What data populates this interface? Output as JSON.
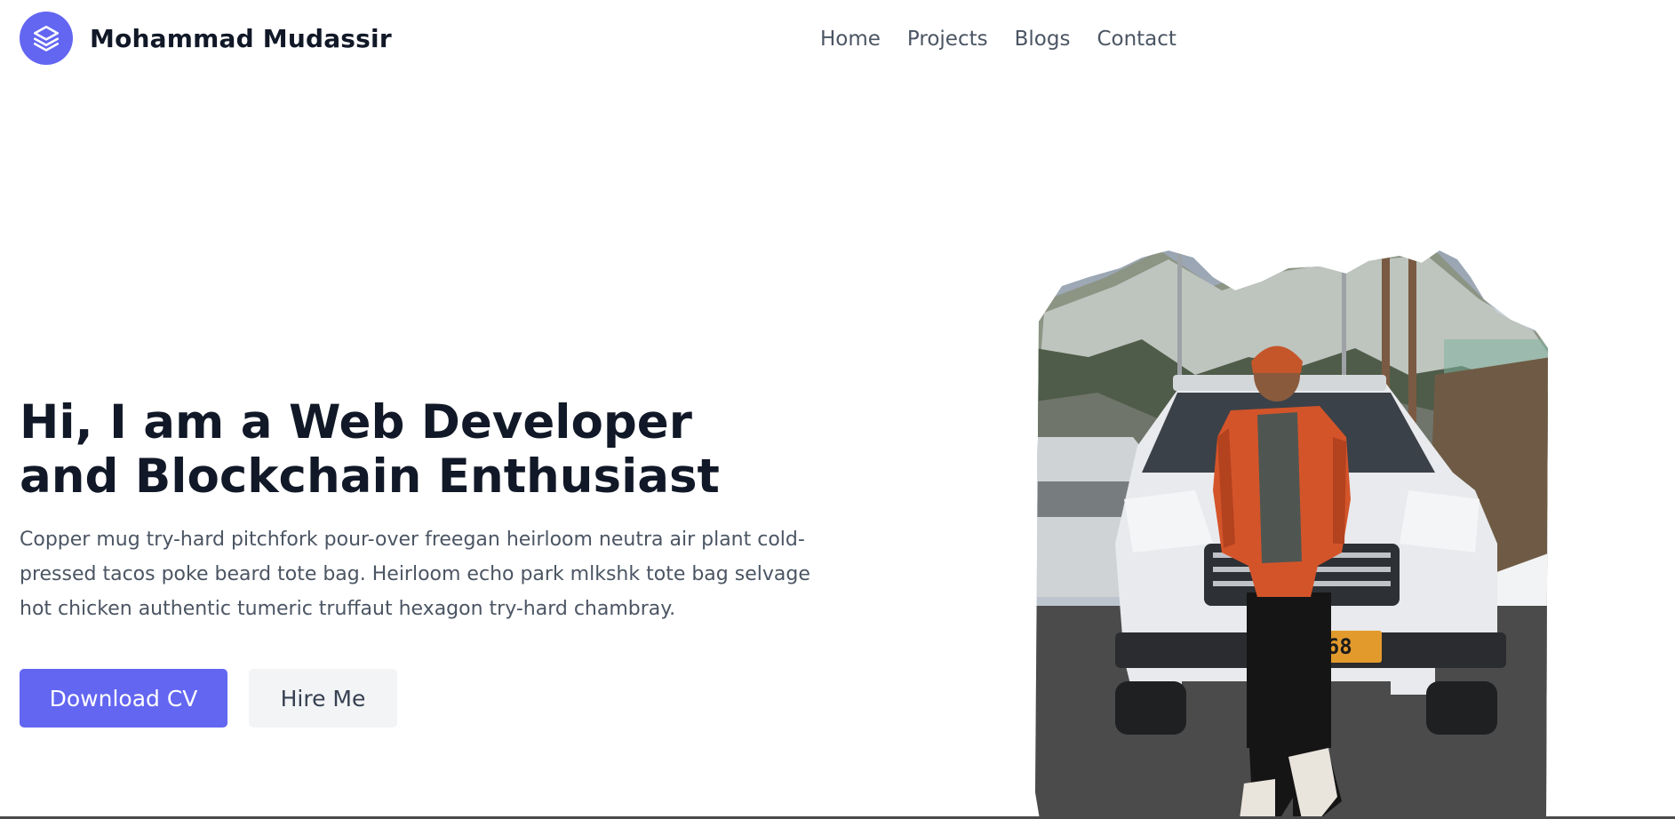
{
  "header": {
    "brand_name": "Mohammad Mudassir",
    "logo_icon": "layers-icon",
    "nav": [
      {
        "label": "Home"
      },
      {
        "label": "Projects"
      },
      {
        "label": "Blogs"
      },
      {
        "label": "Contact"
      }
    ]
  },
  "hero": {
    "title_line1": "Hi, I am a Web Developer",
    "title_line2": "and Blockchain Enthusiast",
    "description": "Copper mug try-hard pitchfork pour-over freegan heirloom neutra air plant cold-pressed tacos poke beard tote bag. Heirloom echo park mlkshk tote bag selvage hot chicken authentic tumeric truffaut hexagon try-hard chambray.",
    "buttons": {
      "primary_label": "Download CV",
      "secondary_label": "Hire Me"
    },
    "photo_plate_text": "468"
  },
  "colors": {
    "accent": "#6366f1",
    "heading": "#111827",
    "body_text": "#4b5563",
    "secondary_button_bg": "#f3f4f6",
    "jacket": "#d4542a"
  }
}
